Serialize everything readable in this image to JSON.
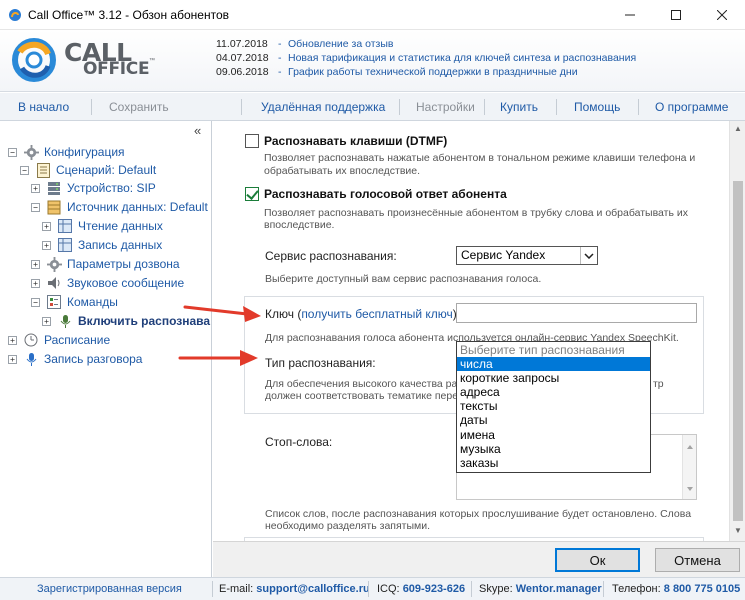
{
  "window": {
    "title": "Call Office™ 3.12 - Обзон абонентов"
  },
  "header": {
    "logo_line1": "CALL",
    "logo_line2": "OFFICE",
    "logo_tm": "™",
    "news": [
      {
        "date": "11.07.2018",
        "text": "Обновление за отзыв"
      },
      {
        "date": "04.07.2018",
        "text": "Новая тарификация и статистика для ключей синтеза и распознавания"
      },
      {
        "date": "09.06.2018",
        "text": "График работы технической поддержки в праздничные дни"
      }
    ]
  },
  "menu": {
    "home": "В начало",
    "save": "Сохранить",
    "remote": "Удалённая поддержка",
    "settings": "Настройки",
    "buy": "Купить",
    "help": "Помощь",
    "about": "О программе"
  },
  "sidebar": {
    "collapse": "«",
    "items": [
      {
        "label": "Конфигурация",
        "expander": "⊟"
      },
      {
        "label": "Сценарий: Default",
        "expander": "⊟"
      },
      {
        "label": "Устройство: SIP",
        "expander": "⊞"
      },
      {
        "label": "Источник данных: Default",
        "expander": "⊟"
      },
      {
        "label": "Чтение данных",
        "expander": "⊞"
      },
      {
        "label": "Запись данных",
        "expander": "⊞"
      },
      {
        "label": "Параметры дозвона",
        "expander": "⊞"
      },
      {
        "label": "Звуковое сообщение",
        "expander": "⊞"
      },
      {
        "label": "Команды",
        "expander": "⊟"
      },
      {
        "label": "Включить распознава",
        "expander": "⊞"
      },
      {
        "label": "Расписание",
        "expander": "⊞"
      },
      {
        "label": "Запись разговора",
        "expander": "⊞"
      }
    ]
  },
  "content": {
    "dtmf": {
      "checked": false,
      "title": "Распознавать клавиши (DTMF)",
      "desc1": "Позволяет распознавать нажатые абонентом в тональном режиме клавиши телефона и",
      "desc2": "обрабатывать их впоследствие."
    },
    "voice": {
      "checked": true,
      "title": "Распознавать голосовой ответ абонента",
      "desc1": "Позволяет распознавать произнесённые абонентом в трубку слова и обрабатывать их",
      "desc2": "впоследствие."
    },
    "service": {
      "label": "Сервис распознавания:",
      "value": "Сервис Yandex",
      "desc": "Выберите доступный вам сервис распознавания голоса."
    },
    "key": {
      "label": "Ключ (",
      "link": "получить бесплатный ключ",
      "label_end": "):",
      "value": "",
      "desc": "Для распознавания голоса абонента используется онлайн-сервис Yandex SpeechKit."
    },
    "type": {
      "label": "Тип распознавания:",
      "desc1": "Для обеспечения высокого качества распознавания",
      "desc1_tail": "тр",
      "desc2": "должен соответствовать тематике пере"
    },
    "type_options": [
      {
        "label": "Выберите тип распознавания",
        "state": "placeholder"
      },
      {
        "label": "числа",
        "state": "selected"
      },
      {
        "label": "короткие запросы",
        "state": "normal"
      },
      {
        "label": "адреса",
        "state": "normal"
      },
      {
        "label": "тексты",
        "state": "normal"
      },
      {
        "label": "даты",
        "state": "normal"
      },
      {
        "label": "имена",
        "state": "normal"
      },
      {
        "label": "музыка",
        "state": "normal"
      },
      {
        "label": "заказы",
        "state": "normal"
      }
    ],
    "stopwords": {
      "label": "Стоп-слова:",
      "value": "",
      "desc1": "Список слов, после распознавания которых прослушивание будет остановлено. Слова",
      "desc2": "необходимо разделять запятыми."
    }
  },
  "buttons": {
    "ok": "Ок",
    "cancel": "Отмена"
  },
  "status": {
    "registered": "Зарегистрированная версия",
    "email_key": "E-mail:",
    "email": "support@calloffice.ru",
    "icq_key": "ICQ:",
    "icq": "609-923-626",
    "skype_key": "Skype:",
    "skype": "Wentor.manager",
    "phone_key": "Телефон:",
    "phone": "8 800 775 0105"
  },
  "colors": {
    "accent": "#1f5aa6",
    "selection": "#0078d7",
    "arrow": "#e23a2a"
  }
}
